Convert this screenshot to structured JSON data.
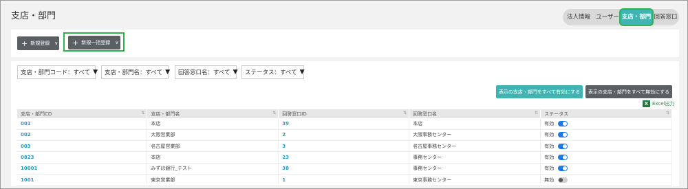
{
  "page": {
    "title": "支店・部門"
  },
  "tabs": [
    {
      "label": "法人情報",
      "active": false
    },
    {
      "label": "ユーザー",
      "active": false
    },
    {
      "label": "支店・部門",
      "active": true
    },
    {
      "label": "回答窓口",
      "active": false
    }
  ],
  "toolbar": {
    "new_label": "新規登録",
    "bulk_label": "新規一括登録",
    "plus": "+",
    "caret": "∨"
  },
  "filters": [
    {
      "label": "支店・部門コード：すべて"
    },
    {
      "label": "支店・部門名：すべて"
    },
    {
      "label": "回答窓口名：すべて"
    },
    {
      "label": "ステータス：すべて"
    }
  ],
  "actions": {
    "enable_all": "表示の支店・部門をすべて有効にする",
    "disable_all": "表示の支店・部門をすべて無効にする",
    "excel": "Excel出力",
    "excel_icon_letter": "X"
  },
  "table": {
    "headers": [
      "支店・部門CD",
      "支店・部門名",
      "回答窓口ID",
      "回答窓口名",
      "ステータス"
    ],
    "sort_glyph": "⇅",
    "rows": [
      {
        "cd": "001",
        "name": "本店",
        "window_id": "39",
        "window_name": "本店",
        "status": "有効",
        "on": true
      },
      {
        "cd": "002",
        "name": "大阪営業部",
        "window_id": "2",
        "window_name": "大阪事務センター",
        "status": "有効",
        "on": true
      },
      {
        "cd": "003",
        "name": "名古屋営業部",
        "window_id": "3",
        "window_name": "名古屋事務センター",
        "status": "有効",
        "on": true
      },
      {
        "cd": "0823",
        "name": "本店",
        "window_id": "23",
        "window_name": "事務センター",
        "status": "有効",
        "on": true
      },
      {
        "cd": "10001",
        "name": "みずほ銀行_テスト",
        "window_id": "38",
        "window_name": "事務センター",
        "status": "有効",
        "on": true
      },
      {
        "cd": "1001",
        "name": "東京営業部",
        "window_id": "1",
        "window_name": "東京事務センター",
        "status": "無効",
        "on": false
      }
    ]
  }
}
